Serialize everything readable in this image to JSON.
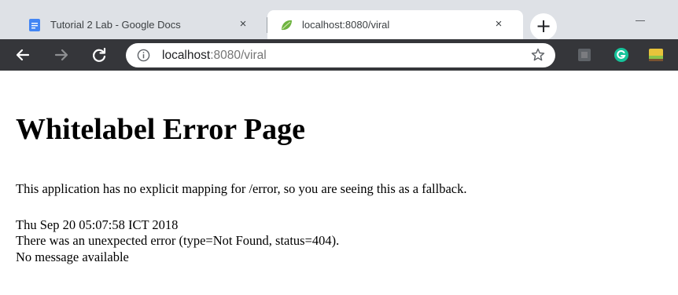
{
  "browser": {
    "tabs": [
      {
        "title": "Tutorial 2 Lab - Google Docs",
        "favicon": "google-docs-icon",
        "active": false,
        "close": "×"
      },
      {
        "title": "localhost:8080/viral",
        "favicon": "spring-leaf-icon",
        "active": true,
        "close": "×"
      }
    ],
    "new_tab": "+",
    "address": {
      "host": "localhost",
      "path": ":8080/viral"
    }
  },
  "page": {
    "heading": "Whitelabel Error Page",
    "message": "This application has no explicit mapping for /error, so you are seeing this as a fallback.",
    "timestamp": "Thu Sep 20 05:07:58 ICT 2018",
    "error": "There was an unexpected error (type=Not Found, status=404).",
    "detail": "No message available"
  },
  "colors": {
    "tabstrip": "#dee1e6",
    "toolbar": "#35363a",
    "docs_blue": "#4285f4",
    "spring_green": "#6db33f",
    "grammarly_green": "#15c39a"
  }
}
